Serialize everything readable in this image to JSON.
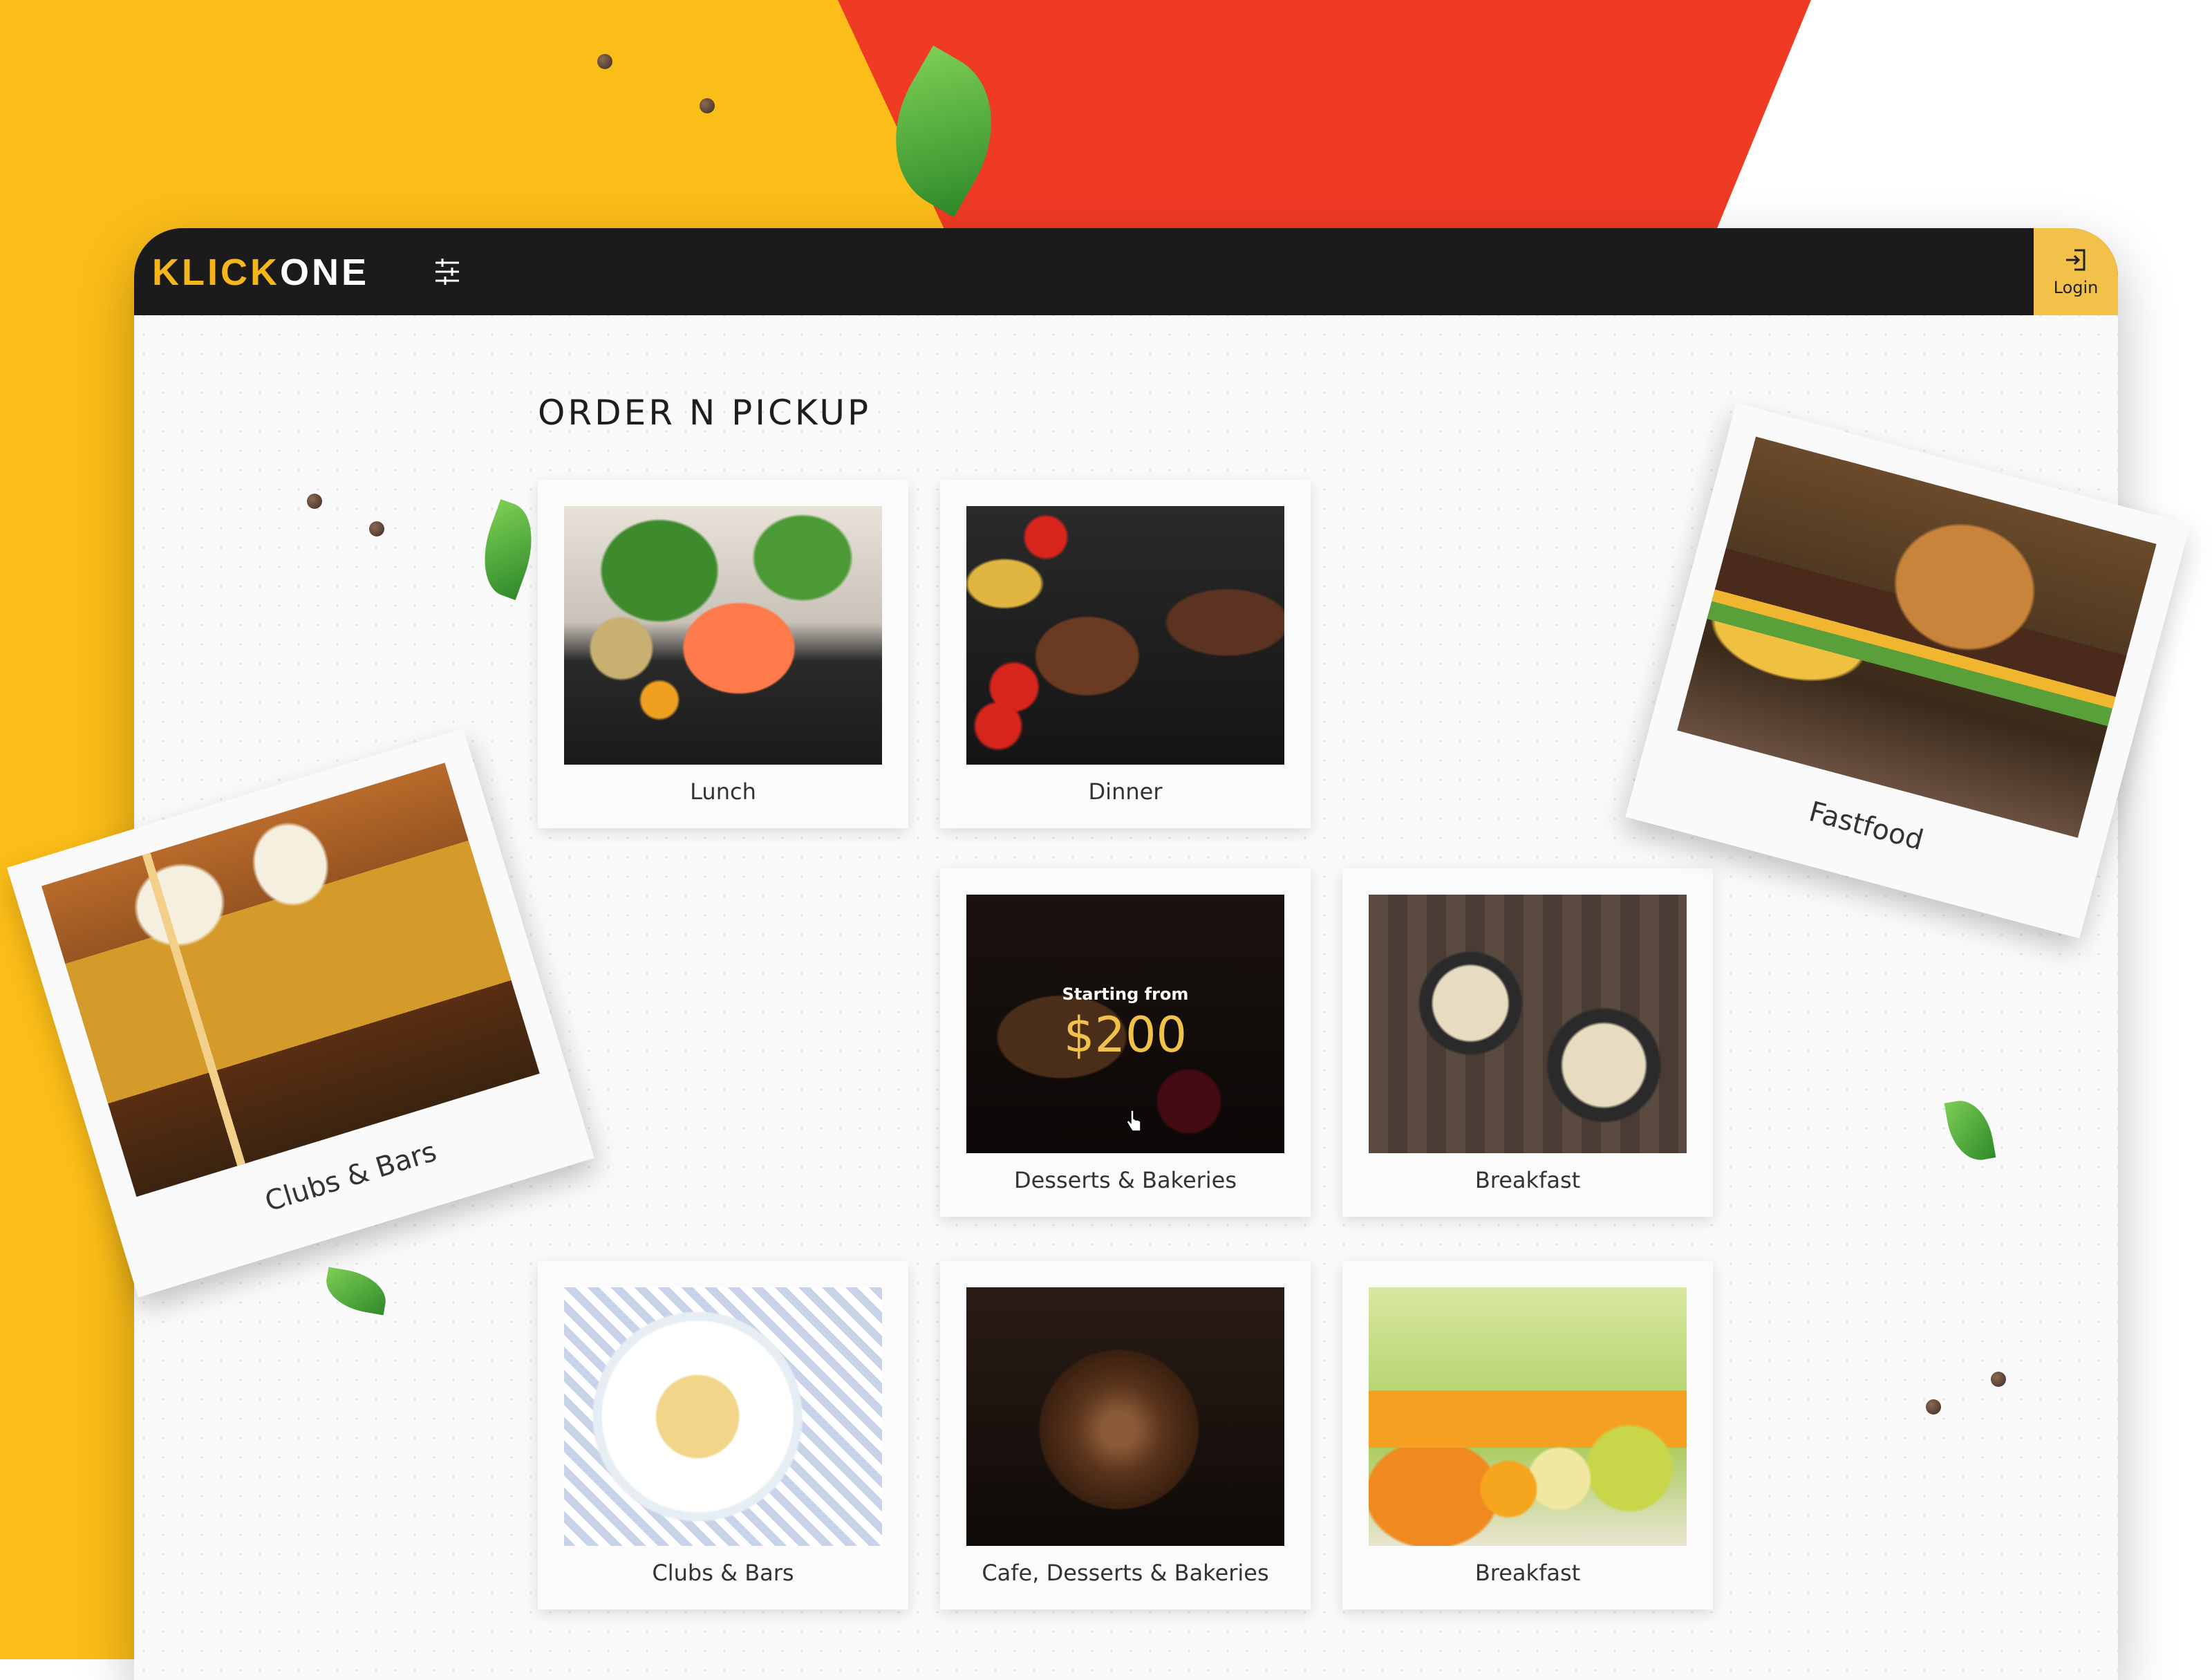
{
  "app": {
    "logo_part1": "KLICK",
    "logo_part2": "ONE",
    "login_label": "Login",
    "filter_icon": "sliders-icon",
    "login_icon": "login-icon"
  },
  "page_title": "ORDER N PICKUP",
  "cards": [
    {
      "label": "Lunch",
      "image": "salmon-photo"
    },
    {
      "label": "Dinner",
      "image": "grill-photo"
    },
    {
      "label": "Desserts & Bakeries",
      "image": "pancakes-photo",
      "overlay_top": "Starting from",
      "overlay_price": "$200"
    },
    {
      "label": "Breakfast",
      "image": "ramen-photo"
    },
    {
      "label": "Clubs & Bars",
      "image": "pasta-photo"
    },
    {
      "label": "Cafe, Desserts & Bakeries",
      "image": "chocolate-photo"
    },
    {
      "label": "Breakfast",
      "image": "juice-photo"
    }
  ],
  "polaroids": [
    {
      "label": "Clubs & Bars",
      "image": "beer-photo"
    },
    {
      "label": "Fastfood",
      "image": "burger-photo"
    }
  ],
  "colors": {
    "brand_yellow": "#f4b61a",
    "accent_red": "#ef3a24",
    "topbar": "#1c1b1b",
    "login_bg": "#f2c14a"
  }
}
